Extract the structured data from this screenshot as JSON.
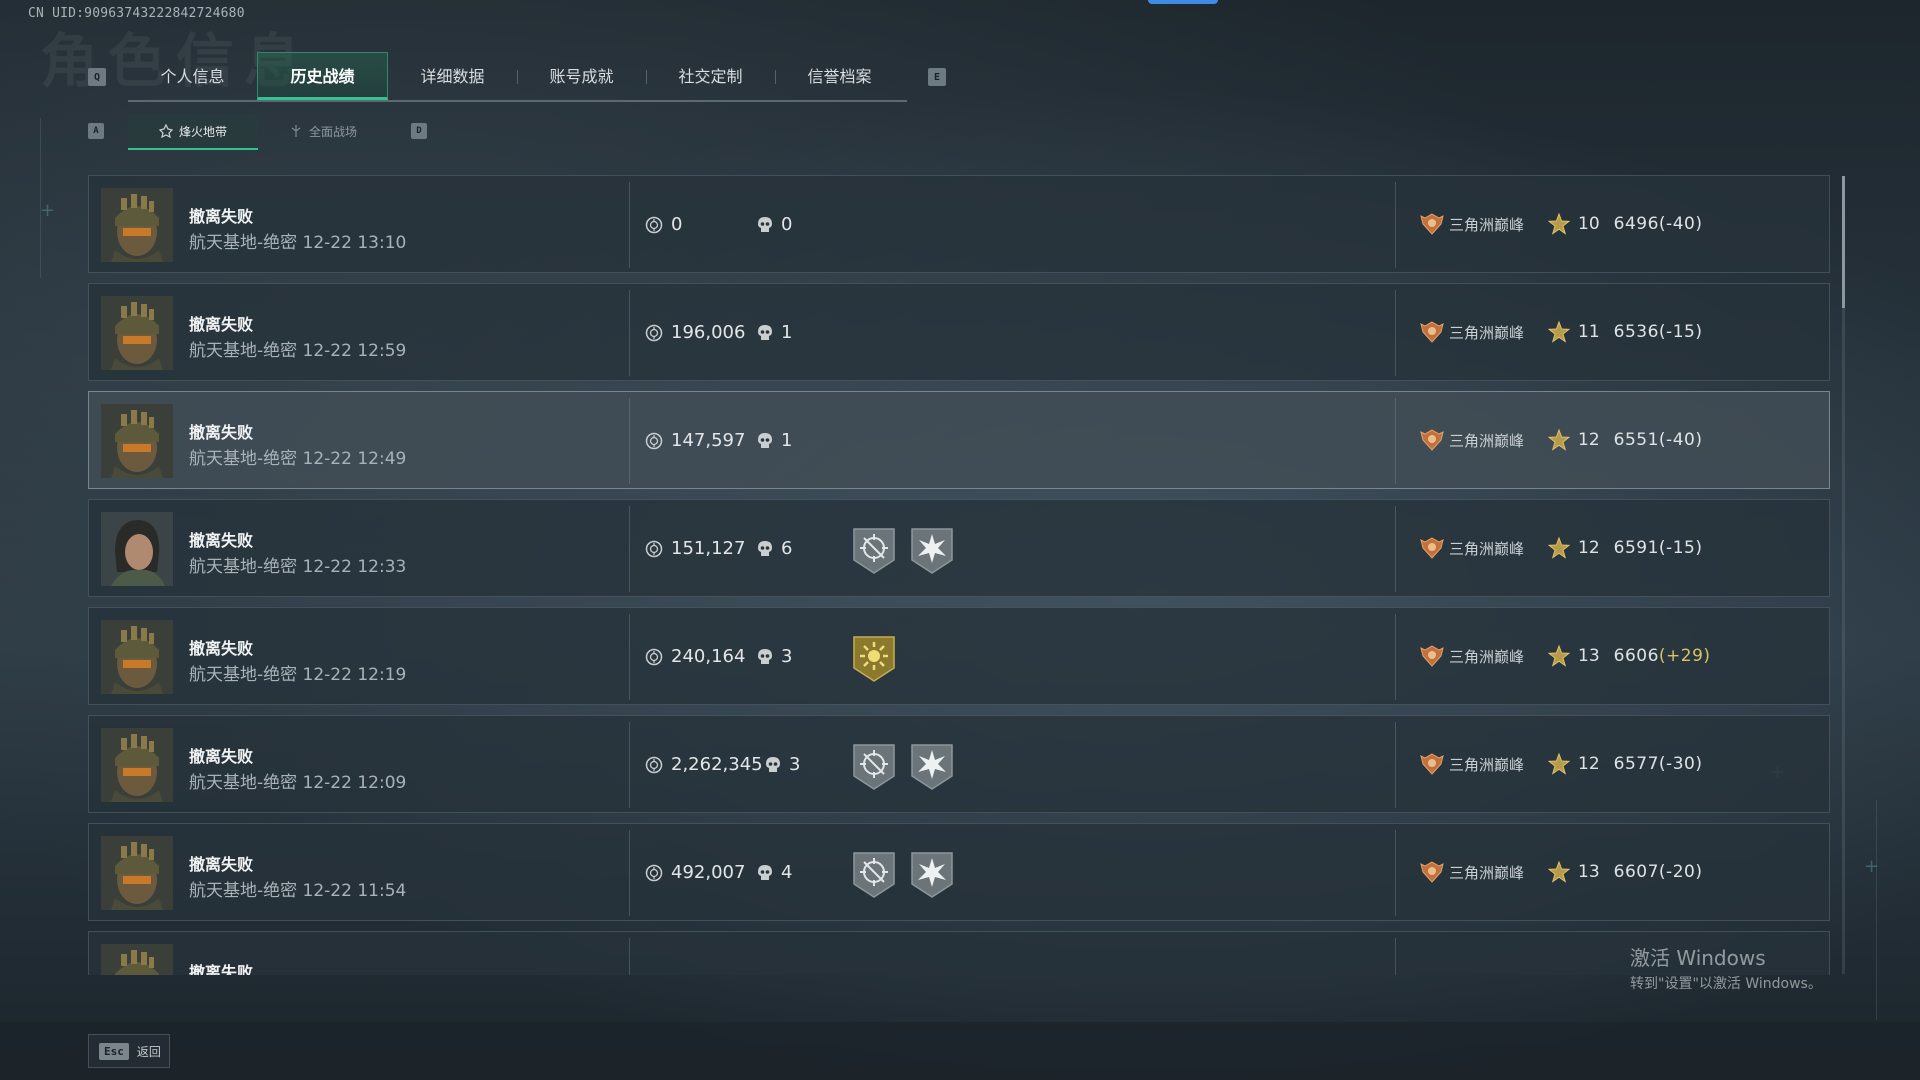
{
  "uid": "CN UID:909637432228427246​80",
  "tabs": {
    "key_left": "Q",
    "key_right": "E",
    "items": [
      {
        "label": "个人信息"
      },
      {
        "label": "历史战绩"
      },
      {
        "label": "详细数据"
      },
      {
        "label": "账号成就"
      },
      {
        "label": "社交定制"
      },
      {
        "label": "信誉档案"
      }
    ],
    "active_index": 1
  },
  "subtabs": {
    "key_left": "A",
    "key_right": "D",
    "items": [
      {
        "label": "烽火地带",
        "icon": "fire-zone-icon"
      },
      {
        "label": "全面战场",
        "icon": "battlefield-icon"
      }
    ],
    "active_index": 0
  },
  "records": [
    {
      "result": "撤离失败",
      "map": "航天基地-绝密 12-22 13:10",
      "value": "0",
      "kills": "0",
      "badges": [],
      "rank_name": "三角洲巅峰",
      "level": "10",
      "score": "6496",
      "delta": "(-40)",
      "avatar": "helmet-operator",
      "highlight": false
    },
    {
      "result": "撤离失败",
      "map": "航天基地-绝密 12-22 12:59",
      "value": "196,006",
      "kills": "1",
      "badges": [],
      "rank_name": "三角洲巅峰",
      "level": "11",
      "score": "6536",
      "delta": "(-15)",
      "avatar": "helmet-operator",
      "highlight": false
    },
    {
      "result": "撤离失败",
      "map": "航天基地-绝密 12-22 12:49",
      "value": "147,597",
      "kills": "1",
      "badges": [],
      "rank_name": "三角洲巅峰",
      "level": "12",
      "score": "6551",
      "delta": "(-40)",
      "avatar": "helmet-operator",
      "highlight": true
    },
    {
      "result": "撤离失败",
      "map": "航天基地-绝密 12-22 12:33",
      "value": "151,127",
      "kills": "6",
      "badges": [
        "crosshair-badge-icon",
        "burst-badge-icon"
      ],
      "rank_name": "三角洲巅峰",
      "level": "12",
      "score": "6591",
      "delta": "(-15)",
      "avatar": "female-operator",
      "highlight": false
    },
    {
      "result": "撤离失败",
      "map": "航天基地-绝密 12-22 12:19",
      "value": "240,164",
      "kills": "3",
      "badges": [
        "gold-sun-badge-icon"
      ],
      "rank_name": "三角洲巅峰",
      "level": "13",
      "score": "6606",
      "delta": "(+29)",
      "avatar": "helmet-operator",
      "highlight": false
    },
    {
      "result": "撤离失败",
      "map": "航天基地-绝密 12-22 12:09",
      "value": "2,262,345",
      "kills": "3",
      "badges": [
        "crosshair-badge-icon",
        "burst-badge-icon"
      ],
      "rank_name": "三角洲巅峰",
      "level": "12",
      "score": "6577",
      "delta": "(-30)",
      "avatar": "helmet-operator",
      "highlight": false
    },
    {
      "result": "撤离失败",
      "map": "航天基地-绝密 12-22 11:54",
      "value": "492,007",
      "kills": "4",
      "badges": [
        "crosshair-badge-icon",
        "burst-badge-icon"
      ],
      "rank_name": "三角洲巅峰",
      "level": "13",
      "score": "6607",
      "delta": "(-20)",
      "avatar": "helmet-operator",
      "highlight": false
    },
    {
      "result": "撤离失败",
      "map": "",
      "value": "",
      "kills": "",
      "badges": [],
      "rank_name": "",
      "level": "",
      "score": "",
      "delta": "",
      "avatar": "helmet-operator",
      "highlight": false
    }
  ],
  "footer": {
    "esc_key": "Esc",
    "back_label": "返回"
  },
  "watermark": {
    "line1": "激活 Windows",
    "line2": "转到\"设置\"以激活 Windows。"
  },
  "colors": {
    "accent_green": "#37c18f",
    "accent_blue": "#3e8be6",
    "positive_delta": "#d8c466"
  }
}
